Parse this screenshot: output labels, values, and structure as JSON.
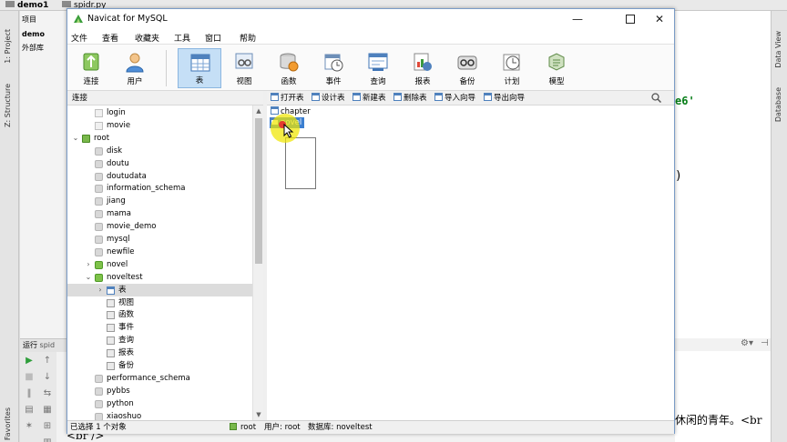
{
  "ide": {
    "tabs": [
      "demo1",
      "spidr.py"
    ],
    "left_strip": {
      "project": "1: Project",
      "structure": "Z: Structure",
      "favorites": "Favorites"
    },
    "right_strip": {
      "data_view": "Data View",
      "database": "Database"
    },
    "project_panel": {
      "root": "项目",
      "item1": "demo",
      "item2": "外部库"
    },
    "editor_fragments": [
      "e6'",
      ")"
    ],
    "run_panel": {
      "label": "运行",
      "config": "spid"
    },
    "output_text": "休闲的青年。<br",
    "output_text2": "<br />"
  },
  "navicat": {
    "title": "Navicat for MySQL",
    "window_controls": {
      "minimize": "—",
      "maximize": "☐",
      "close": "✕"
    },
    "menu": [
      "文件",
      "查看",
      "收藏夹",
      "工具",
      "窗口",
      "帮助"
    ],
    "toolbar": [
      {
        "label": "连接",
        "icon": "connection-icon"
      },
      {
        "label": "用户",
        "icon": "user-icon"
      },
      {
        "label": "表",
        "icon": "table-icon",
        "active": true
      },
      {
        "label": "视图",
        "icon": "view-icon"
      },
      {
        "label": "函数",
        "icon": "function-icon"
      },
      {
        "label": "事件",
        "icon": "event-icon"
      },
      {
        "label": "查询",
        "icon": "query-icon"
      },
      {
        "label": "报表",
        "icon": "report-icon"
      },
      {
        "label": "备份",
        "icon": "backup-icon"
      },
      {
        "label": "计划",
        "icon": "schedule-icon"
      },
      {
        "label": "模型",
        "icon": "model-icon"
      }
    ],
    "connection_header": "连接",
    "tree": [
      {
        "label": "login",
        "kind": "file",
        "level": 1
      },
      {
        "label": "movie",
        "kind": "file",
        "level": 1
      },
      {
        "label": "root",
        "kind": "server",
        "level": 0,
        "expanded": true
      },
      {
        "label": "disk",
        "kind": "db",
        "level": 1
      },
      {
        "label": "doutu",
        "kind": "db",
        "level": 1
      },
      {
        "label": "doutudata",
        "kind": "db",
        "level": 1
      },
      {
        "label": "information_schema",
        "kind": "db",
        "level": 1
      },
      {
        "label": "jiang",
        "kind": "db",
        "level": 1
      },
      {
        "label": "mama",
        "kind": "db",
        "level": 1
      },
      {
        "label": "movie_demo",
        "kind": "db",
        "level": 1
      },
      {
        "label": "mysql",
        "kind": "db",
        "level": 1
      },
      {
        "label": "newfile",
        "kind": "db",
        "level": 1
      },
      {
        "label": "novel",
        "kind": "db-green",
        "level": 1,
        "collapsed": true
      },
      {
        "label": "noveltest",
        "kind": "db-green",
        "level": 1,
        "expanded": true
      },
      {
        "label": "表",
        "kind": "table",
        "level": 2,
        "selected": true,
        "collapsed": true
      },
      {
        "label": "视图",
        "kind": "obj",
        "level": 2
      },
      {
        "label": "函数",
        "kind": "obj",
        "level": 2
      },
      {
        "label": "事件",
        "kind": "obj",
        "level": 2
      },
      {
        "label": "查询",
        "kind": "obj",
        "level": 2
      },
      {
        "label": "报表",
        "kind": "obj",
        "level": 2
      },
      {
        "label": "备份",
        "kind": "obj",
        "level": 2
      },
      {
        "label": "performance_schema",
        "kind": "db",
        "level": 1
      },
      {
        "label": "pybbs",
        "kind": "db",
        "level": 1
      },
      {
        "label": "python",
        "kind": "db",
        "level": 1
      },
      {
        "label": "xiaoshuo",
        "kind": "db",
        "level": 1
      }
    ],
    "object_toolbar": [
      "打开表",
      "设计表",
      "新建表",
      "删除表",
      "导入向导",
      "导出向导"
    ],
    "tables": [
      {
        "name": "chapter",
        "selected": false
      },
      {
        "name": "novel",
        "selected": true
      }
    ],
    "status": {
      "selection": "已选择 1 个对象",
      "connection": "root",
      "user": "用户: root",
      "database": "数据库: noveltest"
    }
  },
  "colors": {
    "accent": "#3c7fd0",
    "active_tool": "#c5dff6",
    "highlight": "#f0e600"
  }
}
